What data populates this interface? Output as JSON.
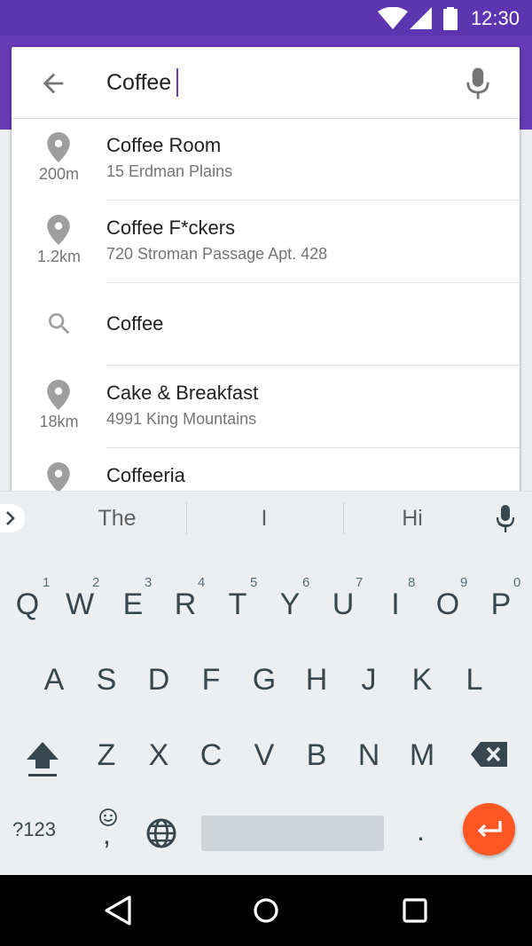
{
  "status": {
    "time": "12:30"
  },
  "search": {
    "value": "Coffee"
  },
  "results": [
    {
      "title": "Coffee Room",
      "subtitle": "15 Erdman Plains",
      "distance": "200m",
      "icon": "place-icon"
    },
    {
      "title": "Coffee F*ckers",
      "subtitle": "720 Stroman Passage Apt. 428",
      "distance": "1.2km",
      "icon": "place-icon"
    },
    {
      "title": "Coffee",
      "icon": "search-icon"
    },
    {
      "title": "Cake & Breakfast",
      "subtitle": "4991 King Mountains",
      "distance": "18km",
      "icon": "place-icon"
    },
    {
      "title": "Coffeeria",
      "icon": "place-icon"
    }
  ],
  "suggestions": [
    "The",
    "I",
    "Hi"
  ],
  "keyboard": {
    "row1": [
      "Q",
      "W",
      "E",
      "R",
      "T",
      "Y",
      "U",
      "I",
      "O",
      "P"
    ],
    "row1_hints": [
      "1",
      "2",
      "3",
      "4",
      "5",
      "6",
      "7",
      "8",
      "9",
      "0"
    ],
    "row2": [
      "A",
      "S",
      "D",
      "F",
      "G",
      "H",
      "J",
      "K",
      "L"
    ],
    "row3": [
      "Z",
      "X",
      "C",
      "V",
      "B",
      "N",
      "M"
    ],
    "symbols_label": "?123",
    "comma": ",",
    "period": ".",
    "accent_color": "#FF5722"
  },
  "colors": {
    "primary": "#673AB7",
    "primary_dark": "#5E35B1"
  }
}
